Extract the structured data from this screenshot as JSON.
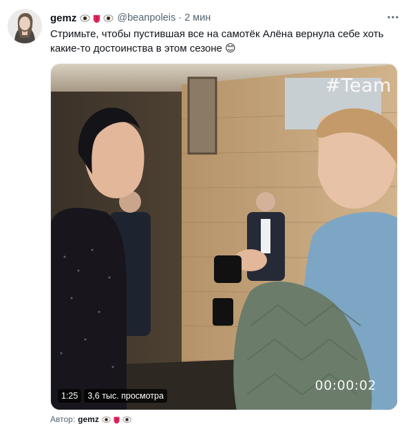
{
  "tweet": {
    "author_name": "gemz",
    "author_emojis": [
      "eye-emoji",
      "tongue-emoji",
      "eye-emoji"
    ],
    "handle": "@beanpoleis",
    "separator": "·",
    "time": "2 мин",
    "text": "Стримьте, чтобы пустившая все на самотёк Алёна вернула себе хоть какие-то достоинства в этом сезоне 😊"
  },
  "media": {
    "overlay_tag": "#Team",
    "timecode": "00:00:02",
    "duration": "1:25",
    "views": "3,6 тыс. просмотра"
  },
  "attribution": {
    "label": "Автор:",
    "name": "gemz"
  },
  "icons": {
    "more": "more-dots-icon"
  }
}
